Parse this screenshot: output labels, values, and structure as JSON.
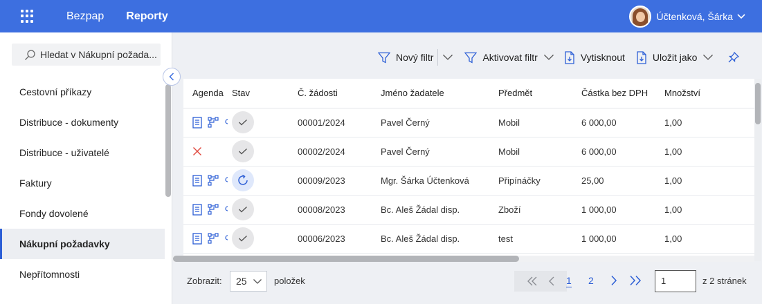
{
  "topbar": {
    "nav": [
      "Bezpap",
      "Reporty"
    ],
    "user_name": "Účtenková, Šárka"
  },
  "sidebar": {
    "search_placeholder": "Hledat v Nákupní požada...",
    "items": [
      {
        "label": "Cestovní příkazy",
        "active": false
      },
      {
        "label": "Distribuce - dokumenty",
        "active": false
      },
      {
        "label": "Distribuce - uživatelé",
        "active": false
      },
      {
        "label": "Faktury",
        "active": false
      },
      {
        "label": "Fondy dovolené",
        "active": false
      },
      {
        "label": "Nákupní požadavky",
        "active": true
      },
      {
        "label": "Nepřítomnosti",
        "active": false
      }
    ]
  },
  "toolbar": {
    "new_filter": "Nový filtr",
    "activate_filter": "Aktivovat filtr",
    "print": "Vytisknout",
    "save_as": "Uložit jako"
  },
  "table": {
    "headers": [
      "Agenda",
      "Stav",
      "Č. žádosti",
      "Jméno žadatele",
      "Předmět",
      "Částka bez DPH",
      "Množství"
    ],
    "rows": [
      {
        "agenda": "icons",
        "status": "approved",
        "cislo": "00001/2024",
        "jmeno": "Pavel Černý",
        "predmet": "Mobil",
        "castka": "6 000,00",
        "mnozstvi": "1,00"
      },
      {
        "agenda": "rejected",
        "status": "approved",
        "cislo": "00002/2024",
        "jmeno": "Pavel Černý",
        "predmet": "Mobil",
        "castka": "6 000,00",
        "mnozstvi": "1,00"
      },
      {
        "agenda": "icons",
        "status": "in-progress",
        "cislo": "00009/2023",
        "jmeno": "Mgr. Šárka Účtenková",
        "predmet": "Připínáčky",
        "castka": "25,00",
        "mnozstvi": "1,00"
      },
      {
        "agenda": "icons",
        "status": "approved",
        "cislo": "00008/2023",
        "jmeno": "Bc. Aleš Žádal disp.",
        "predmet": "Zboží",
        "castka": "1 000,00",
        "mnozstvi": "1,00"
      },
      {
        "agenda": "icons",
        "status": "approved",
        "cislo": "00006/2023",
        "jmeno": "Bc. Aleš Žádal disp.",
        "predmet": "test",
        "castka": "1 000,00",
        "mnozstvi": "1,00"
      }
    ]
  },
  "pager": {
    "show_label": "Zobrazit:",
    "page_size": "25",
    "items_label": "položek",
    "pages": [
      "1",
      "2"
    ],
    "current_page_input": "1",
    "total_label": "z 2 stránek"
  },
  "colors": {
    "accent": "#3d6fe0",
    "link": "#2d5fd6",
    "reject": "#e0483e"
  }
}
